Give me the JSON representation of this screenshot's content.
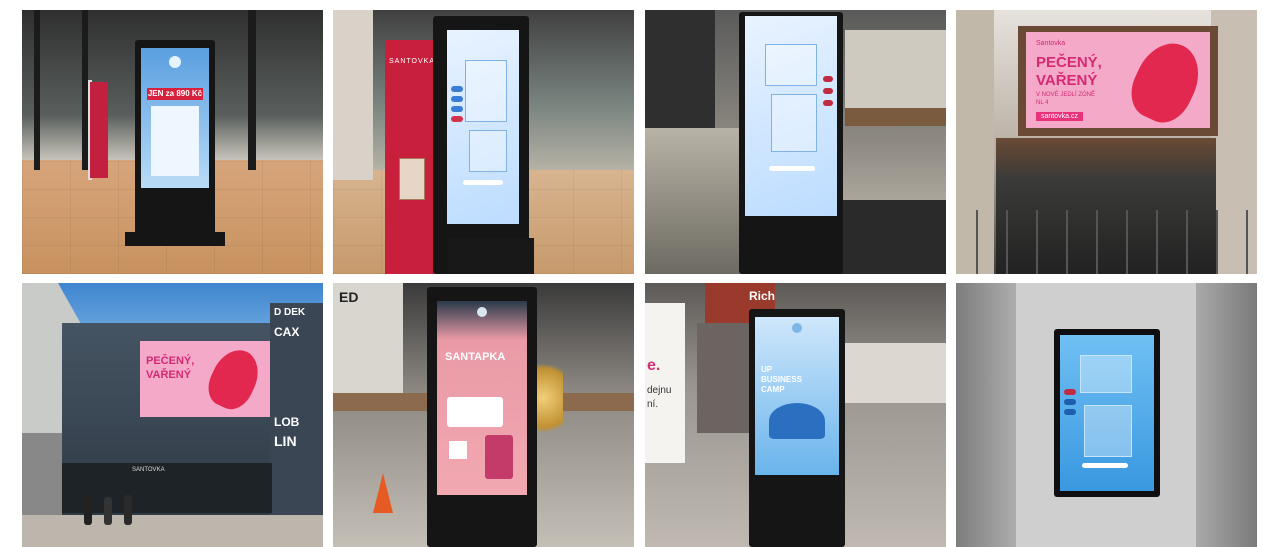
{
  "photos": [
    {
      "scene": "entrance-kiosk",
      "screen_text": {
        "promo": "JEN za 890 Kč"
      }
    },
    {
      "scene": "kiosk-with-banner",
      "screen_text": {
        "banner": "SANTOVKA"
      }
    },
    {
      "scene": "atrium-kiosk-map",
      "screen_text": {}
    },
    {
      "scene": "billboard-food",
      "screen_text": {
        "brand": "Santovka",
        "headline_1": "PEČENÝ,",
        "headline_2": "VAŘENÝ",
        "sub": "V NOVÉ JEDLÍ ZÓNĚ",
        "sub2": "NL 4",
        "url": "santovka.cz"
      }
    },
    {
      "scene": "facade-billboard",
      "screen_text": {
        "headline_1": "PEČENÝ,",
        "headline_2": "VAŘENÝ",
        "sign_1": "D DEK",
        "sign_2": "CAX",
        "sign_3": "LOB",
        "sign_4": "LIN",
        "store": "SANTOVKA"
      }
    },
    {
      "scene": "santapka-kiosk",
      "screen_text": {
        "headline": "SANTAPKA",
        "store_sign": "ED"
      }
    },
    {
      "scene": "business-camp-kiosk",
      "screen_text": {
        "title_1": "UP",
        "title_2": "BUSINESS",
        "title_3": "CAMP",
        "wall_1": "e.",
        "wall_2": "dejnu",
        "wall_3": "ní.",
        "store": "Rich"
      }
    },
    {
      "scene": "wall-mounted-map",
      "screen_text": {}
    }
  ],
  "colors": {
    "pink_brand": "#e8337a",
    "billboard_pink": "#f4a9c9",
    "red_banner": "#c8203c",
    "screen_blue": "#5ab2ef"
  }
}
